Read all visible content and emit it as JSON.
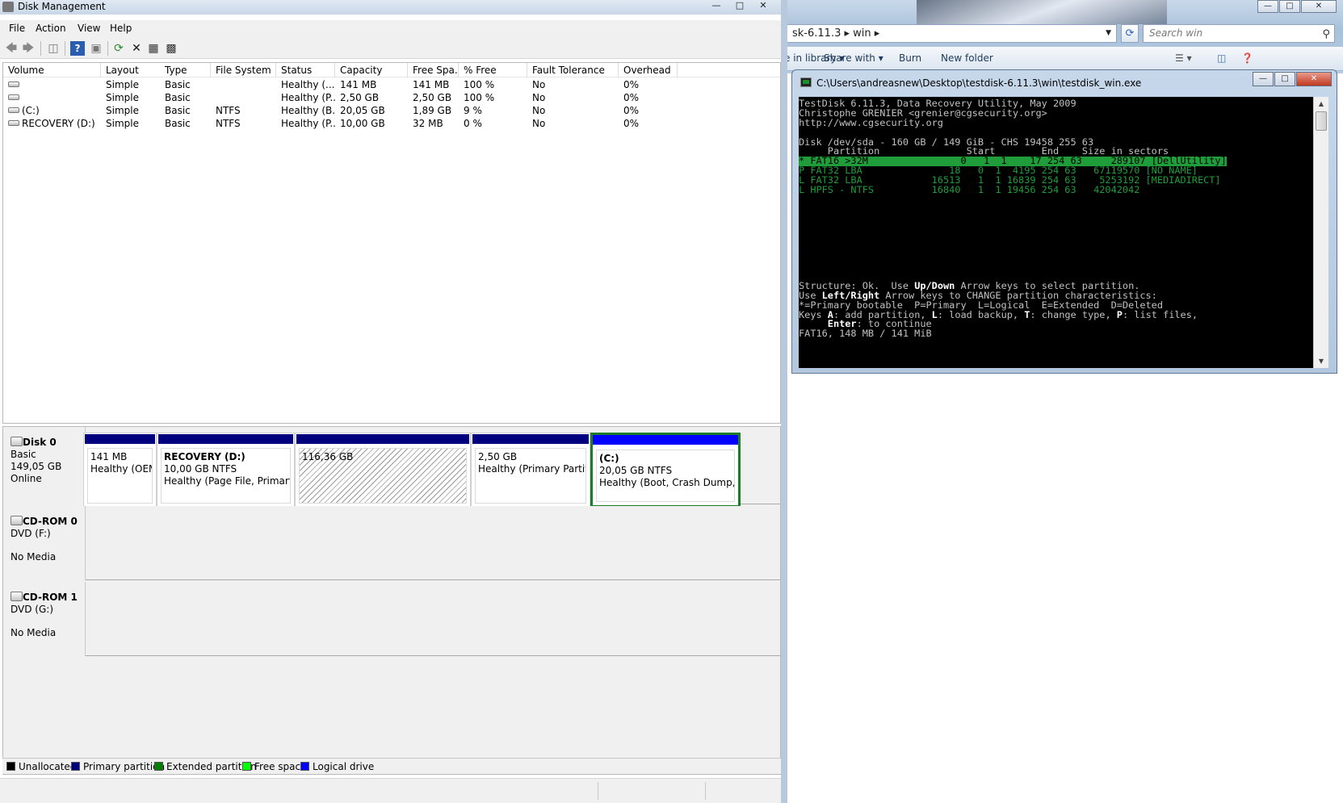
{
  "explorer": {
    "address": "sk-6.11.3  ▸  win  ▸",
    "search_placeholder": "Search win",
    "commands": [
      "e in library ▾",
      "Share with ▾",
      "Burn",
      "New folder"
    ]
  },
  "console": {
    "title": "C:\\Users\\andreasnew\\Desktop\\testdisk-6.11.3\\win\\testdisk_win.exe",
    "lines": [
      "TestDisk 6.11.3, Data Recovery Utility, May 2009",
      "Christophe GRENIER <grenier@cgsecurity.org>",
      "http://www.cgsecurity.org",
      "",
      "Disk /dev/sda - 160 GB / 149 GiB - CHS 19458 255 63",
      "     Partition               Start        End    Size in sectors"
    ],
    "partitions": [
      "* FAT16 >32M                0   1  1    17 254 63     289107 [DellUtility]",
      "P FAT32 LBA               18   0  1  4195 254 63   67119570 [NO NAME]",
      "L FAT32 LBA            16513   1  1 16839 254 63    5253192 [MEDIADIRECT]",
      "L HPFS - NTFS          16840   1  1 19456 254 63   42042042"
    ],
    "footer": [
      "Structure: Ok.  Use |Up/Down| Arrow keys to select partition.",
      "Use |Left/Right| Arrow keys to CHANGE partition characteristics:",
      "*=Primary bootable  P=Primary  L=Logical  E=Extended  D=Deleted",
      "Keys |A|: add partition, |L|: load backup, |T|: change type, |P|: list files,",
      "     |Enter|: to continue",
      "FAT16, 148 MB / 141 MiB"
    ]
  },
  "dm": {
    "title": "Disk Management",
    "menu": [
      "File",
      "Action",
      "View",
      "Help"
    ],
    "columns": [
      "Volume",
      "Layout",
      "Type",
      "File System",
      "Status",
      "Capacity",
      "Free Spa...",
      "% Free",
      "Fault Tolerance",
      "Overhead"
    ],
    "rows": [
      [
        "",
        "Simple",
        "Basic",
        "",
        "Healthy (...",
        "141 MB",
        "141 MB",
        "100 %",
        "No",
        "0%"
      ],
      [
        "",
        "Simple",
        "Basic",
        "",
        "Healthy (P...",
        "2,50 GB",
        "2,50 GB",
        "100 %",
        "No",
        "0%"
      ],
      [
        "(C:)",
        "Simple",
        "Basic",
        "NTFS",
        "Healthy (B...",
        "20,05 GB",
        "1,89 GB",
        "9 %",
        "No",
        "0%"
      ],
      [
        "RECOVERY (D:)",
        "Simple",
        "Basic",
        "NTFS",
        "Healthy (P...",
        "10,00 GB",
        "32 MB",
        "0 %",
        "No",
        "0%"
      ]
    ],
    "disks": [
      {
        "name": "Disk 0",
        "type": "Basic",
        "size": "149,05 GB",
        "state": "Online"
      },
      {
        "name": "CD-ROM 0",
        "type": "DVD (F:)",
        "size": "",
        "state": "No Media"
      },
      {
        "name": "CD-ROM 1",
        "type": "DVD (G:)",
        "size": "",
        "state": "No Media"
      }
    ],
    "partitions": [
      {
        "title": "",
        "size": "141 MB",
        "status": "Healthy (OEM Partition)"
      },
      {
        "title": "RECOVERY  (D:)",
        "size": "10,00 GB NTFS",
        "status": "Healthy (Page File, Primary Partition)"
      },
      {
        "title": "",
        "size": "116,36 GB",
        "status": ""
      },
      {
        "title": "",
        "size": "2,50 GB",
        "status": "Healthy (Primary Partition)"
      },
      {
        "title": "(C:)",
        "size": "20,05 GB NTFS",
        "status": "Healthy (Boot, Crash Dump, Logical Drive)"
      }
    ],
    "legend": [
      {
        "label": "Unallocated",
        "color": "#000000"
      },
      {
        "label": "Primary partition",
        "color": "#00007f"
      },
      {
        "label": "Extended partition",
        "color": "#007f00"
      },
      {
        "label": "Free space",
        "color": "#00ff00"
      },
      {
        "label": "Logical drive",
        "color": "#0000ff"
      }
    ]
  }
}
